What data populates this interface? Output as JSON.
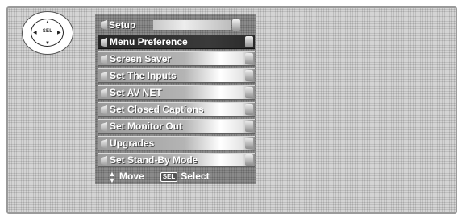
{
  "remote": {
    "center_label": "SEL",
    "up": "▲",
    "down": "▼",
    "left": "◀",
    "right": "▶"
  },
  "menu": {
    "title": "Setup",
    "items": [
      {
        "label": "Menu Preference",
        "selected": true
      },
      {
        "label": "Screen Saver",
        "selected": false
      },
      {
        "label": "Set The Inputs",
        "selected": false
      },
      {
        "label": "Set AV NET",
        "selected": false
      },
      {
        "label": "Set Closed Captions",
        "selected": false
      },
      {
        "label": "Set Monitor Out",
        "selected": false
      },
      {
        "label": "Upgrades",
        "selected": false
      },
      {
        "label": "Set Stand-By Mode",
        "selected": false
      }
    ]
  },
  "footer": {
    "move_icon": "up-down-arrows",
    "move_label": "Move",
    "select_key": "SEL",
    "select_label": "Select"
  }
}
